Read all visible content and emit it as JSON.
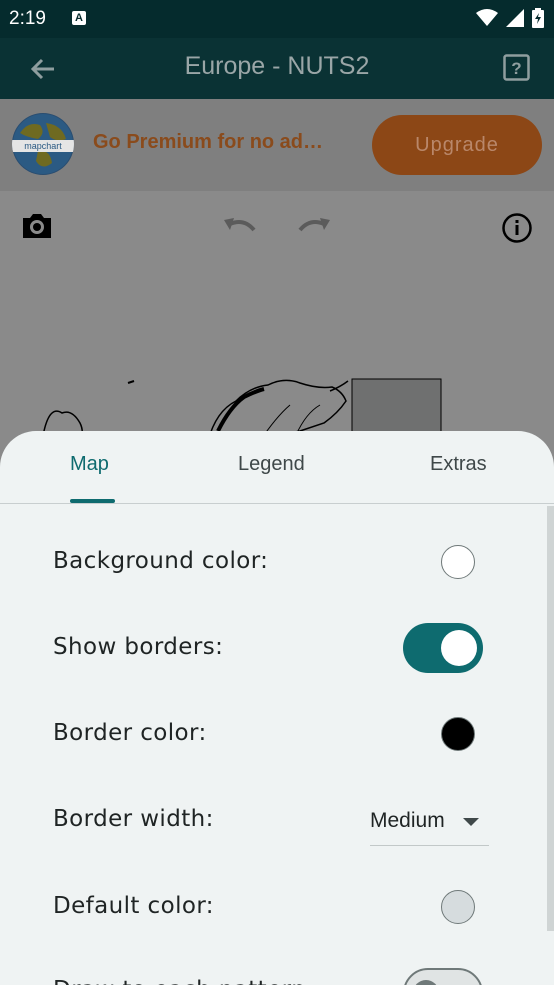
{
  "status_bar": {
    "time": "2:19",
    "notification_badge": "A",
    "icons": [
      "wifi-icon",
      "signal-icon",
      "battery-icon"
    ]
  },
  "app_bar": {
    "title": "Europe - NUTS2",
    "back_icon": "arrow-left-icon",
    "help_icon": "help-square-icon"
  },
  "ad_banner": {
    "logo_text": "mapchart",
    "text": "Go Premium for no ad…",
    "upgrade_label": "Upgrade"
  },
  "toolbar": {
    "icons": [
      "camera-icon",
      "undo-icon",
      "redo-icon",
      "info-icon"
    ]
  },
  "sheet": {
    "tabs": [
      {
        "label": "Map",
        "active": true
      },
      {
        "label": "Legend",
        "active": false
      },
      {
        "label": "Extras",
        "active": false
      }
    ],
    "settings": {
      "background_color_label": "Background color:",
      "background_color_value": "#ffffff",
      "show_borders_label": "Show borders:",
      "show_borders_value": true,
      "border_color_label": "Border color:",
      "border_color_value": "#000000",
      "border_width_label": "Border width:",
      "border_width_value": "Medium",
      "default_color_label": "Default color:",
      "default_color_value": "#d6dcde",
      "partial_label": "Draw to each pattern",
      "partial_value": false
    }
  },
  "colors": {
    "accent": "#0e6b6f",
    "status_bar": "#052b2d",
    "app_bar": "#0a3234",
    "upgrade": "#8c4716"
  }
}
